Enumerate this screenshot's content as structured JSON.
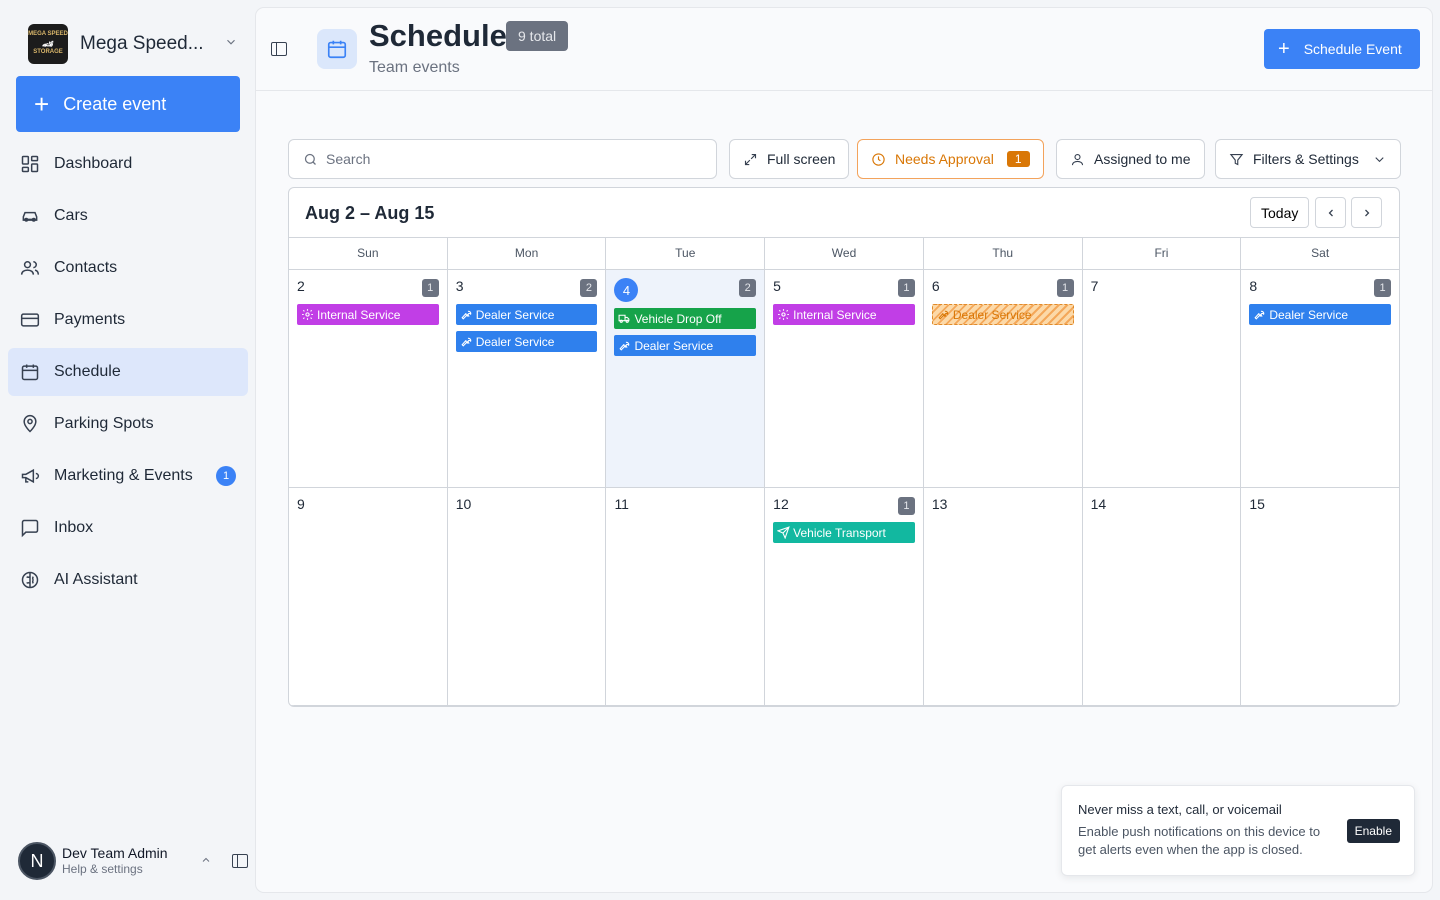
{
  "brand": {
    "name": "Mega Speed...",
    "logo_line1": "MEGA SPEED",
    "logo_line2": "STORAGE"
  },
  "sidebar": {
    "create_label": "Create event",
    "items": [
      {
        "label": "Dashboard",
        "icon": "dashboard-icon"
      },
      {
        "label": "Cars",
        "icon": "car-icon"
      },
      {
        "label": "Contacts",
        "icon": "contacts-icon"
      },
      {
        "label": "Payments",
        "icon": "card-icon"
      },
      {
        "label": "Schedule",
        "icon": "calendar-icon",
        "active": true
      },
      {
        "label": "Parking Spots",
        "icon": "pin-icon"
      },
      {
        "label": "Marketing & Events",
        "icon": "megaphone-icon",
        "badge": "1"
      },
      {
        "label": "Inbox",
        "icon": "inbox-icon"
      },
      {
        "label": "AI Assistant",
        "icon": "brain-icon"
      }
    ]
  },
  "user": {
    "initial": "N",
    "name": "Dev Team Admin",
    "sub": "Help & settings"
  },
  "header": {
    "title": "Schedule",
    "total": "9 total",
    "subtitle": "Team events",
    "cta": "Schedule Event"
  },
  "toolbar": {
    "search_placeholder": "Search",
    "fullscreen": "Full screen",
    "needs_approval": "Needs Approval",
    "needs_approval_count": "1",
    "assigned": "Assigned to me",
    "filters": "Filters & Settings"
  },
  "calendar": {
    "range": "Aug 2 – Aug 15",
    "today_label": "Today",
    "dow": [
      "Sun",
      "Mon",
      "Tue",
      "Wed",
      "Thu",
      "Fri",
      "Sat"
    ],
    "weeks": [
      [
        {
          "day": "2",
          "count": "1",
          "events": [
            {
              "title": "Internal Service",
              "color": "purple",
              "icon": "gear"
            }
          ]
        },
        {
          "day": "3",
          "count": "2",
          "events": [
            {
              "title": "Dealer Service",
              "color": "blue",
              "icon": "wrench"
            },
            {
              "title": "Dealer Service",
              "color": "blue",
              "icon": "wrench"
            }
          ]
        },
        {
          "day": "4",
          "count": "2",
          "today": true,
          "events": [
            {
              "title": "Vehicle Drop Off",
              "color": "green",
              "icon": "truck"
            },
            {
              "title": "Dealer Service",
              "color": "blue",
              "icon": "wrench"
            }
          ]
        },
        {
          "day": "5",
          "count": "1",
          "events": [
            {
              "title": "Internal Service",
              "color": "purple",
              "icon": "gear"
            }
          ]
        },
        {
          "day": "6",
          "count": "1",
          "events": [
            {
              "title": "Dealer Service",
              "color": "pending",
              "icon": "wrench"
            }
          ]
        },
        {
          "day": "7",
          "count": "",
          "events": []
        },
        {
          "day": "8",
          "count": "1",
          "events": [
            {
              "title": "Dealer Service",
              "color": "blue",
              "icon": "wrench"
            }
          ]
        }
      ],
      [
        {
          "day": "9",
          "count": "",
          "events": []
        },
        {
          "day": "10",
          "count": "",
          "events": []
        },
        {
          "day": "11",
          "count": "",
          "events": []
        },
        {
          "day": "12",
          "count": "1",
          "events": [
            {
              "title": "Vehicle Transport",
              "color": "teal",
              "icon": "send"
            }
          ]
        },
        {
          "day": "13",
          "count": "",
          "events": []
        },
        {
          "day": "14",
          "count": "",
          "events": []
        },
        {
          "day": "15",
          "count": "",
          "events": []
        }
      ]
    ]
  },
  "toast": {
    "title": "Never miss a text, call, or voicemail",
    "body": "Enable push notifications on this device to get alerts even when the app is closed.",
    "button": "Enable"
  }
}
